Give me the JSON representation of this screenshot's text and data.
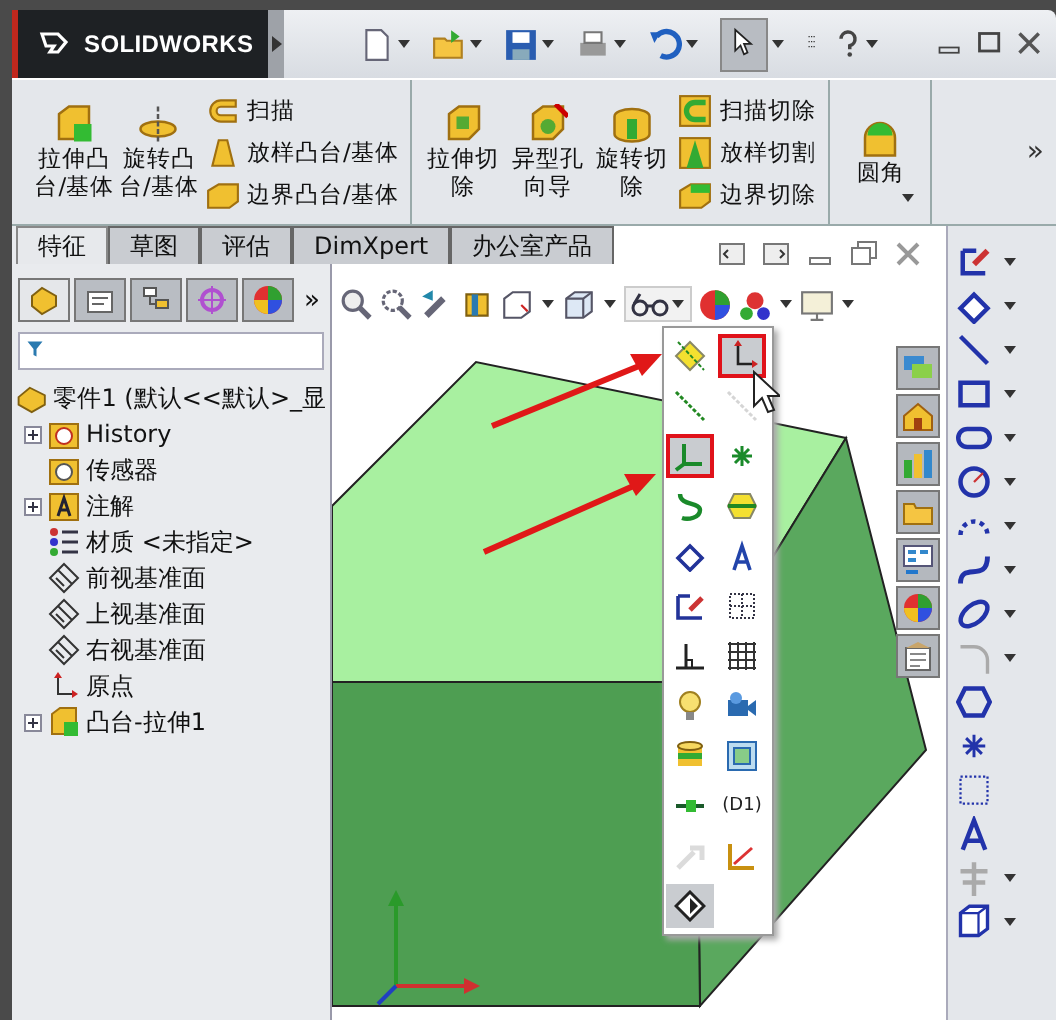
{
  "titlebar": {
    "logo": "SOLIDWORKS"
  },
  "ribbon": {
    "groups": [
      {
        "large": [
          {
            "label": "拉伸凸台/基体"
          },
          {
            "label": "旋转凸台/基体"
          }
        ],
        "small": [
          {
            "label": "扫描"
          },
          {
            "label": "放样凸台/基体"
          },
          {
            "label": "边界凸台/基体"
          }
        ]
      },
      {
        "large": [
          {
            "label": "拉伸切除"
          },
          {
            "label": "异型孔向导"
          },
          {
            "label": "旋转切除"
          }
        ],
        "small": [
          {
            "label": "扫描切除"
          },
          {
            "label": "放样切割"
          },
          {
            "label": "边界切除"
          }
        ]
      },
      {
        "large": [
          {
            "label": "圆角"
          }
        ]
      }
    ],
    "more": "»"
  },
  "tabs": [
    {
      "label": "特征",
      "selected": true
    },
    {
      "label": "草图",
      "selected": false
    },
    {
      "label": "评估",
      "selected": false
    },
    {
      "label": "DimXpert",
      "selected": false
    },
    {
      "label": "办公室产品",
      "selected": false
    }
  ],
  "feature_manager": {
    "panel_tabs": [
      {
        "selected": true
      },
      {
        "selected": false
      },
      {
        "selected": false
      },
      {
        "selected": false
      },
      {
        "selected": false
      }
    ],
    "more": "»",
    "tree": {
      "label": "零件1  (默认<<默认>_显",
      "children": [
        {
          "label": "History",
          "expandable": true
        },
        {
          "label": "传感器",
          "expandable": false
        },
        {
          "label": "注解",
          "expandable": true
        },
        {
          "label": "材质 <未指定>",
          "expandable": false
        },
        {
          "label": "前视基准面",
          "expandable": false
        },
        {
          "label": "上视基准面",
          "expandable": false
        },
        {
          "label": "右视基准面",
          "expandable": false
        },
        {
          "label": "原点",
          "expandable": false
        },
        {
          "label": "凸台-拉伸1",
          "expandable": true
        }
      ]
    }
  },
  "view_menu": {
    "items": [
      {
        "framed": false,
        "pressed": false,
        "disabled": false
      },
      {
        "framed": true,
        "pressed": true,
        "disabled": false
      },
      {
        "framed": false,
        "pressed": false,
        "disabled": false
      },
      {
        "framed": false,
        "pressed": false,
        "disabled": true
      },
      {
        "framed": true,
        "pressed": true,
        "disabled": false
      },
      {
        "framed": false,
        "pressed": false,
        "disabled": false
      },
      {
        "framed": false,
        "pressed": false,
        "disabled": false
      },
      {
        "framed": false,
        "pressed": false,
        "disabled": false
      },
      {
        "framed": false,
        "pressed": false,
        "disabled": false
      },
      {
        "framed": false,
        "pressed": false,
        "disabled": false
      },
      {
        "framed": false,
        "pressed": false,
        "disabled": false
      },
      {
        "framed": false,
        "pressed": false,
        "disabled": false
      },
      {
        "framed": false,
        "pressed": false,
        "disabled": false
      },
      {
        "framed": false,
        "pressed": false,
        "disabled": false
      },
      {
        "framed": false,
        "pressed": false,
        "disabled": false
      },
      {
        "framed": false,
        "pressed": false,
        "disabled": false
      },
      {
        "framed": false,
        "pressed": false,
        "disabled": false
      },
      {
        "framed": false,
        "pressed": false,
        "disabled": false
      },
      {
        "framed": false,
        "pressed": false,
        "disabled": false
      },
      {
        "framed": false,
        "pressed": false,
        "disabled": false,
        "label": "(D1)"
      },
      {
        "framed": false,
        "pressed": false,
        "disabled": true
      },
      {
        "framed": false,
        "pressed": false,
        "disabled": false
      },
      {
        "framed": false,
        "pressed": true,
        "disabled": false
      }
    ]
  }
}
